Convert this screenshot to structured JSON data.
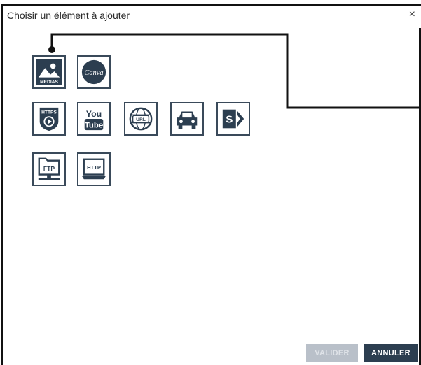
{
  "dialog": {
    "title": "Choisir un élément à ajouter",
    "close_symbol": "×"
  },
  "tiles": [
    {
      "name": "medias",
      "label": "MEDIAS",
      "icon": "image-icon"
    },
    {
      "name": "canva",
      "label": "Canva",
      "icon": "canva-icon"
    },
    {
      "name": "https-video",
      "label": "HTTPS",
      "icon": "https-video-icon"
    },
    {
      "name": "youtube",
      "label_top": "You",
      "label_bottom": "Tube",
      "icon": "youtube-icon"
    },
    {
      "name": "url",
      "label": "URL",
      "icon": "globe-url-icon"
    },
    {
      "name": "car",
      "icon": "car-icon"
    },
    {
      "name": "sharepoint",
      "label": "S",
      "icon": "sharepoint-icon"
    },
    {
      "name": "ftp",
      "label": "FTP",
      "icon": "ftp-folder-icon"
    },
    {
      "name": "http",
      "label": "HTTP",
      "icon": "http-laptop-icon"
    }
  ],
  "buttons": {
    "validate_label": "VALIDER",
    "cancel_label": "ANNULER"
  },
  "colors": {
    "tile_dark": "#2c3e50",
    "button_disabled": "#b9c0c9",
    "button_primary": "#2c3e50"
  }
}
